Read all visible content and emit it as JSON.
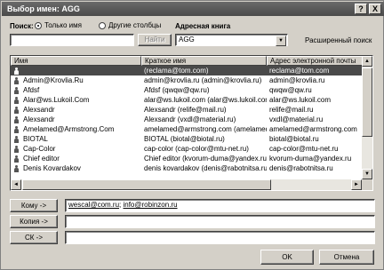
{
  "window": {
    "title": "Выбор имен: AGG",
    "close_glyph": "X",
    "help_glyph": "?"
  },
  "search": {
    "label": "Поиск:",
    "option_names_only": "Только имя",
    "option_other_columns": "Другие столбцы",
    "address_book_label": "Адресная книга",
    "query_value": "",
    "find_button": "Найти",
    "address_book_value": "AGG",
    "advanced_search": "Расширенный поиск"
  },
  "list": {
    "columns": [
      "Имя",
      "Краткое имя",
      "Адрес электронной почты"
    ],
    "rows": [
      {
        "name": "",
        "alias": "(reclama@tom.com)",
        "email": "reclama@tom.com",
        "selected": true
      },
      {
        "name": "Admin@Krovlia.Ru",
        "alias": "admin@krovlia.ru (admin@krovlia.ru)",
        "email": "admin@krovlia.ru"
      },
      {
        "name": "Afdsf",
        "alias": "Afdsf (qwqw@qw.ru)",
        "email": "qwqw@qw.ru"
      },
      {
        "name": "Alar@ws.Lukoil.Com",
        "alias": "alar@ws.lukoil.com (alar@ws.lukoil.com)",
        "email": "alar@ws.lukoil.com"
      },
      {
        "name": "Alexsandr",
        "alias": "Alexsandr (relife@mail.ru)",
        "email": "relife@mail.ru"
      },
      {
        "name": "Alexsandr",
        "alias": "Alexsandr (vxdl@material.ru)",
        "email": "vxdl@material.ru"
      },
      {
        "name": "Amelamed@Armstrong.Com",
        "alias": "amelamed@armstrong.com (amelamed@armstrong.com)",
        "email": "amelamed@armstrong.com"
      },
      {
        "name": "BIOTAL",
        "alias": "BIOTAL (biotal@biotal.ru)",
        "email": "biotal@biotal.ru"
      },
      {
        "name": "Cap-Color",
        "alias": "cap-color (cap-color@mtu-net.ru)",
        "email": "cap-color@mtu-net.ru"
      },
      {
        "name": "Chief editor",
        "alias": "Chief editor (kvorum-duma@yandex.ru)",
        "email": "kvorum-duma@yandex.ru"
      },
      {
        "name": "Denis Kovardakov",
        "alias": "denis kovardakov (denis@rabotnitsa.ru)",
        "email": "denis@rabotnitsa.ru"
      }
    ]
  },
  "recipients": {
    "to_button": "Кому ->",
    "to_value_1": "wescal@com.ru",
    "to_separator": "; ",
    "to_value_2": "info@robinzon.ru",
    "cc_button": "Копия ->",
    "cc_value": "",
    "bcc_button": "СК ->",
    "bcc_value": ""
  },
  "footer": {
    "ok_button": "OK",
    "cancel_button": "Отмена"
  },
  "scroll": {
    "up": "▲",
    "down": "▼",
    "left": "◄",
    "right": "►"
  }
}
